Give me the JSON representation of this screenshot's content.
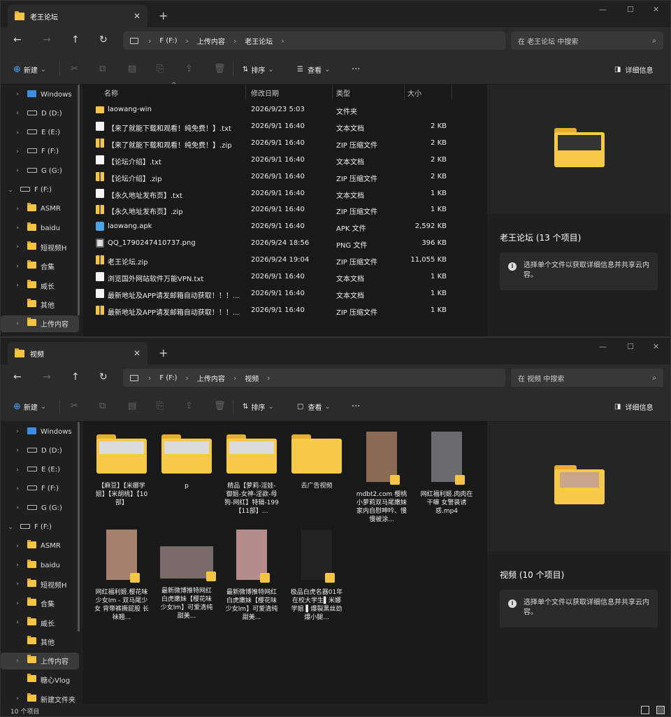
{
  "win1": {
    "tab_title": "老王论坛",
    "breadcrumb": [
      "F (F:)",
      "上传内容",
      "老王论坛"
    ],
    "search_placeholder": "在 老王论坛 中搜索",
    "commands": {
      "new": "新建",
      "sort": "排序",
      "view": "查看",
      "more": "···",
      "details": "详细信息"
    },
    "columns": [
      "名称",
      "修改日期",
      "类型",
      "大小"
    ],
    "nav": [
      {
        "label": "Windows",
        "icon": "windows-drive-icon",
        "chev": "›"
      },
      {
        "label": "D (D:)",
        "icon": "drive-icon",
        "chev": "›"
      },
      {
        "label": "E (E:)",
        "icon": "drive-icon",
        "chev": "›"
      },
      {
        "label": "F (F:)",
        "icon": "drive-icon",
        "chev": "›"
      },
      {
        "label": "G (G:)",
        "icon": "drive-icon",
        "chev": "›"
      },
      {
        "label": "F (F:)",
        "icon": "drive-icon",
        "chev": "⌄"
      },
      {
        "label": "ASMR",
        "icon": "folder-icon",
        "chev": "›"
      },
      {
        "label": "baidu",
        "icon": "folder-icon",
        "chev": "›"
      },
      {
        "label": "短视频H",
        "icon": "folder-icon",
        "chev": "›"
      },
      {
        "label": "合集",
        "icon": "folder-icon",
        "chev": "›"
      },
      {
        "label": "威长",
        "icon": "folder-icon",
        "chev": "›"
      },
      {
        "label": "其他",
        "icon": "folder-icon",
        "chev": ""
      },
      {
        "label": "上传内容",
        "icon": "folder-icon",
        "chev": "›"
      }
    ],
    "files": [
      {
        "name": "laowang-win",
        "date": "2026/9/23 5:03",
        "type": "文件夹",
        "size": "",
        "icon": "folder"
      },
      {
        "name": "【来了就能下载和观看！纯免费！】.txt",
        "date": "2026/9/1 16:40",
        "type": "文本文档",
        "size": "2 KB",
        "icon": "txt"
      },
      {
        "name": "【来了就能下载和观看！纯免费！】.zip",
        "date": "2026/9/1 16:40",
        "type": "ZIP 压缩文件",
        "size": "2 KB",
        "icon": "zip"
      },
      {
        "name": "【论坛介绍】.txt",
        "date": "2026/9/1 16:40",
        "type": "文本文档",
        "size": "2 KB",
        "icon": "txt"
      },
      {
        "name": "【论坛介绍】.zip",
        "date": "2026/9/1 16:40",
        "type": "ZIP 压缩文件",
        "size": "2 KB",
        "icon": "zip"
      },
      {
        "name": "【永久地址发布页】.txt",
        "date": "2026/9/1 16:40",
        "type": "文本文档",
        "size": "1 KB",
        "icon": "txt"
      },
      {
        "name": "【永久地址发布页】.zip",
        "date": "2026/9/1 16:40",
        "type": "ZIP 压缩文件",
        "size": "1 KB",
        "icon": "zip"
      },
      {
        "name": "laowang.apk",
        "date": "2026/9/1 16:40",
        "type": "APK 文件",
        "size": "2,592 KB",
        "icon": "apk"
      },
      {
        "name": "QQ_1790247410737.png",
        "date": "2026/9/24 18:56",
        "type": "PNG 文件",
        "size": "396 KB",
        "icon": "png"
      },
      {
        "name": "老王论坛.zip",
        "date": "2026/9/24 19:04",
        "type": "ZIP 压缩文件",
        "size": "11,055 KB",
        "icon": "zip"
      },
      {
        "name": "浏览国外网站软件万能VPN.txt",
        "date": "2026/9/1 16:40",
        "type": "文本文档",
        "size": "1 KB",
        "icon": "txt"
      },
      {
        "name": "最新地址及APP请发邮箱自动获取！！！...",
        "date": "2026/9/1 16:40",
        "type": "文本文档",
        "size": "1 KB",
        "icon": "txt"
      },
      {
        "name": "最新地址及APP请发邮箱自动获取！！！...",
        "date": "2026/9/1 16:40",
        "type": "ZIP 压缩文件",
        "size": "1 KB",
        "icon": "zip"
      }
    ],
    "detail_title": "老王论坛 (13 个项目)",
    "detail_info": "选择单个文件以获取详细信息并共享云内容。"
  },
  "win2": {
    "tab_title": "视频",
    "breadcrumb": [
      "F (F:)",
      "上传内容",
      "视频"
    ],
    "search_placeholder": "在 视频 中搜索",
    "nav": [
      {
        "label": "Windows",
        "icon": "windows-drive-icon",
        "chev": "›"
      },
      {
        "label": "D (D:)",
        "icon": "drive-icon",
        "chev": "›"
      },
      {
        "label": "E (E:)",
        "icon": "drive-icon",
        "chev": "›"
      },
      {
        "label": "F (F:)",
        "icon": "drive-icon",
        "chev": "›"
      },
      {
        "label": "G (G:)",
        "icon": "drive-icon",
        "chev": "›"
      },
      {
        "label": "F (F:)",
        "icon": "drive-icon",
        "chev": "⌄"
      },
      {
        "label": "ASMR",
        "icon": "folder-icon",
        "chev": "›"
      },
      {
        "label": "baidu",
        "icon": "folder-icon",
        "chev": "›"
      },
      {
        "label": "短视频H",
        "icon": "folder-icon",
        "chev": "›"
      },
      {
        "label": "合集",
        "icon": "folder-icon",
        "chev": "›"
      },
      {
        "label": "威长",
        "icon": "folder-icon",
        "chev": "›"
      },
      {
        "label": "其他",
        "icon": "folder-icon",
        "chev": ""
      },
      {
        "label": "上传内容",
        "icon": "folder-icon",
        "chev": "›"
      },
      {
        "label": "糖心Vlog",
        "icon": "folder-icon",
        "chev": ""
      },
      {
        "label": "新建文件夹",
        "icon": "folder-icon",
        "chev": "›"
      }
    ],
    "items": [
      {
        "label": "【麻豆】【米娜学姐】【米胡桃】【10部】",
        "kind": "folder"
      },
      {
        "label": "p",
        "kind": "folder"
      },
      {
        "label": "精品【萝莉-淫娃-御姐-女神-淫欲-母狗-网红】特辑-199【11部】...",
        "kind": "folder"
      },
      {
        "label": "去广告视频",
        "kind": "folder-empty"
      },
      {
        "label": "mdbt2.com 樱桃小萝莉双马尾嫩妹家内自慰呻吟、慢慢被涂...",
        "kind": "video"
      },
      {
        "label": "网红福利姬.肉肉在干嘛 女警装诱惑.mp4",
        "kind": "video"
      },
      {
        "label": "网红福利姬.樱花味少女Im - 双马尾少女 背带裤撅屁股 长袜翘...",
        "kind": "video"
      },
      {
        "label": "最新微博推特网红白虎嫩妹【樱花味少女Im】可爱清纯甜美...",
        "kind": "video-wide"
      },
      {
        "label": "最新微博推特网红白虎嫩妹【樱花味少女Im】可爱清纯甜美...",
        "kind": "video"
      },
      {
        "label": "极品白虎名器01年在校大学生▌米娜学姐 ▌爆裂黑丝劲爆小腿...",
        "kind": "video"
      }
    ],
    "detail_title": "视频 (10 个项目)",
    "detail_info": "选择单个文件以获取详细信息并共享云内容。",
    "status": "10 个项目"
  }
}
